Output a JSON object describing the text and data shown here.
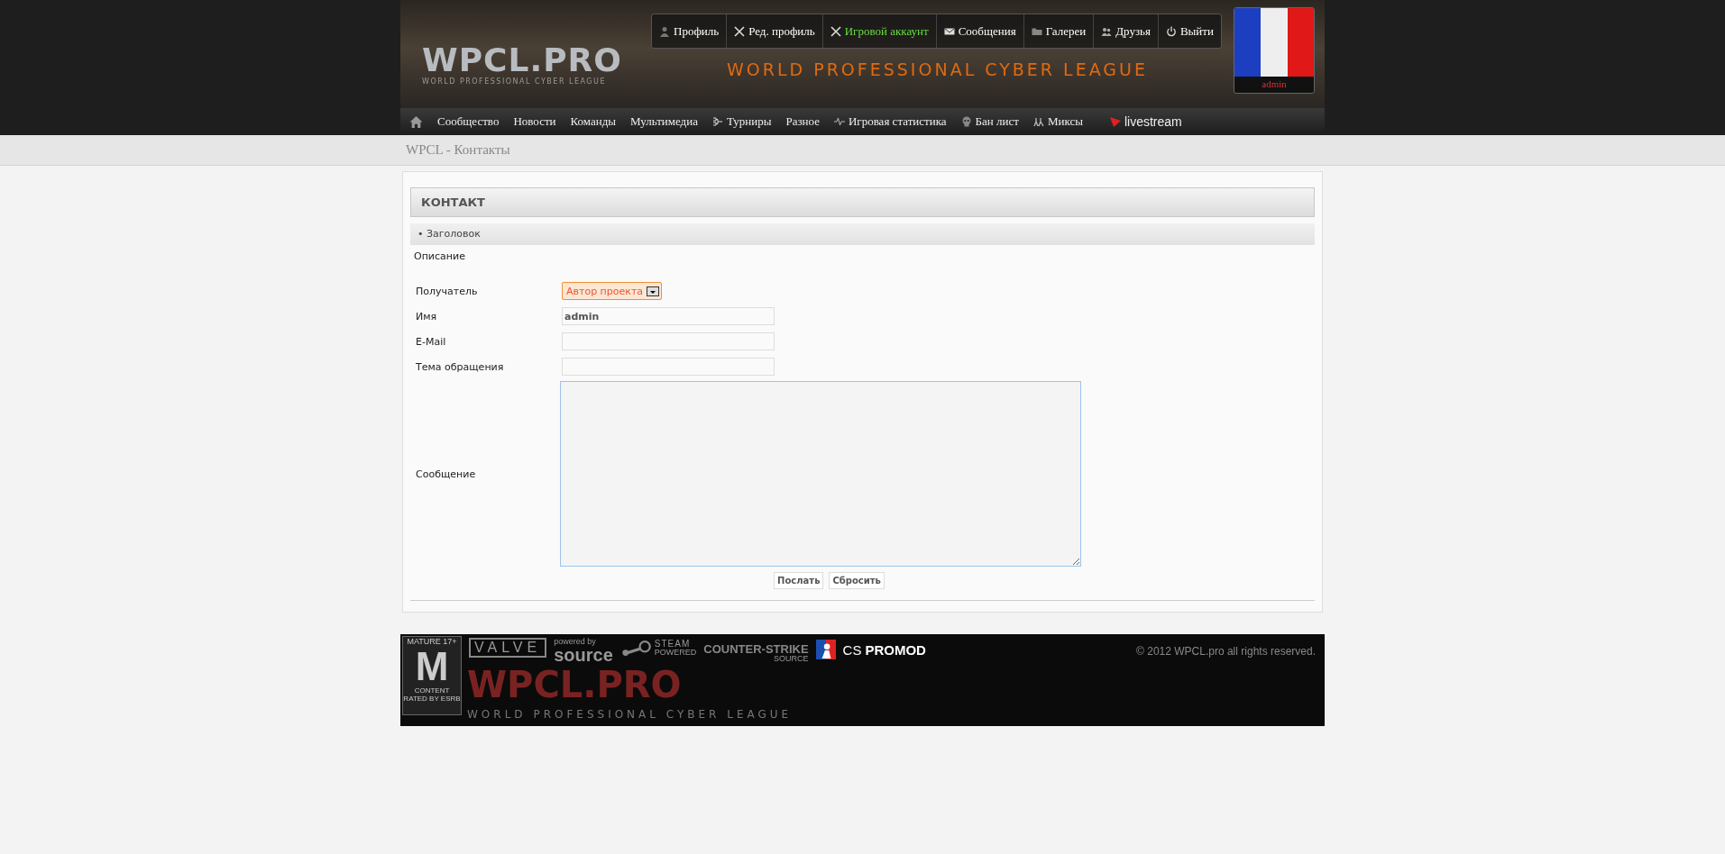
{
  "header": {
    "logo": "WPCL.PRO",
    "logo_subtitle": "WORLD PROFESSIONAL CYBER LEAGUE",
    "tagline": "WORLD PROFESSIONAL CYBER LEAGUE",
    "user_menu": [
      {
        "label": "Профиль",
        "kind": "person",
        "color": "#ffffff"
      },
      {
        "label": "Ред. профиль",
        "kind": "cross",
        "color": "#ffffff"
      },
      {
        "label": "Игровой аккаунт",
        "kind": "cross",
        "color": "#66dd44"
      },
      {
        "label": "Сообщения",
        "kind": "mail",
        "color": "#ffffff"
      },
      {
        "label": "Галереи",
        "kind": "folder",
        "color": "#ffffff"
      },
      {
        "label": "Друзья",
        "kind": "people",
        "color": "#ffffff"
      },
      {
        "label": "Выйти",
        "kind": "power",
        "color": "#ffffff"
      }
    ],
    "user": {
      "name": "admin"
    }
  },
  "nav": [
    {
      "kind": "home"
    },
    {
      "label": "Сообщество",
      "kind": "text"
    },
    {
      "label": "Новости",
      "kind": "text"
    },
    {
      "label": "Команды",
      "kind": "text"
    },
    {
      "label": "Мультимедиа",
      "kind": "text"
    },
    {
      "label": "Турниры",
      "kind": "bracket"
    },
    {
      "label": "Разное",
      "kind": "text"
    },
    {
      "label": "Игровая статистика",
      "kind": "pulse"
    },
    {
      "label": "Бан лист",
      "kind": "skull"
    },
    {
      "label": "Миксы",
      "kind": "figure"
    },
    {
      "label": "livestream",
      "kind": "live"
    }
  ],
  "breadcrumb": "WPCL - Контакты",
  "contact": {
    "title": "КОНТАКТ",
    "section": "• Заголовок",
    "description": "Описание",
    "fields": [
      {
        "label": "Получатель",
        "kind": "select",
        "value": "Автор проекта"
      },
      {
        "label": "Имя",
        "kind": "text",
        "value": "admin"
      },
      {
        "label": "E-Mail",
        "kind": "text"
      },
      {
        "label": "Тема обращения",
        "kind": "text"
      },
      {
        "label": "Сообщение",
        "kind": "textarea"
      }
    ],
    "buttons": [
      "Послать",
      "Сбросить"
    ]
  },
  "footer": {
    "logos": [
      {
        "kind": "esrb",
        "top": "MATURE 17+",
        "big": "M",
        "bottom": "CONTENT RATED BY ESRB"
      },
      {
        "kind": "valve",
        "text": "VALVE"
      },
      {
        "kind": "source",
        "small": "powered by",
        "text": "source"
      },
      {
        "kind": "steam",
        "text": "STEAM",
        "small": "POWERED"
      },
      {
        "kind": "cs",
        "text": "COUNTER-STRIKE",
        "small": "SOURCE"
      },
      {
        "kind": "promod",
        "text": "CS",
        "bold": "PROMOD"
      }
    ],
    "copyright": "© 2012 WPCL.pro all rights reserved.",
    "watermark": "WPCL.PRO",
    "watermark_sub": "WORLD PROFESSIONAL CYBER LEAGUE"
  }
}
